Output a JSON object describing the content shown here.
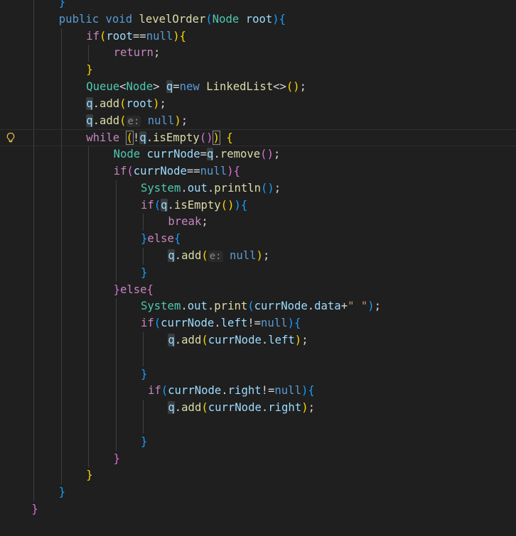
{
  "theme": {
    "background": "#1f1f1f",
    "keyword": "#569cd6",
    "control": "#c586c0",
    "type": "#4ec9b0",
    "function": "#dcdcaa",
    "variable": "#9cdcfe",
    "field": "#9cdcfe",
    "plain": "#d4d4d4",
    "string": "#ce9178",
    "bracket1": "#ffd700",
    "bracket2": "#da70d6",
    "bracket3": "#179fff",
    "hint": "#8a8a8a"
  },
  "editor": {
    "gutter_icon": "lightbulb-icon",
    "lines": [
      {
        "indent": 2,
        "tokens": [
          {
            "t": "}",
            "c": "bracket3"
          }
        ]
      },
      {
        "indent": 2,
        "tokens": [
          {
            "t": "public",
            "c": "keyword"
          },
          {
            "t": " "
          },
          {
            "t": "void",
            "c": "keyword"
          },
          {
            "t": " "
          },
          {
            "t": "levelOrder",
            "c": "function"
          },
          {
            "t": "(",
            "c": "bracket3"
          },
          {
            "t": "Node",
            "c": "type"
          },
          {
            "t": " "
          },
          {
            "t": "root",
            "c": "variable"
          },
          {
            "t": ")",
            "c": "bracket3"
          },
          {
            "t": "{",
            "c": "bracket3"
          }
        ]
      },
      {
        "indent": 3,
        "tokens": [
          {
            "t": "if",
            "c": "control"
          },
          {
            "t": "(",
            "c": "bracket1"
          },
          {
            "t": "root",
            "c": "variable"
          },
          {
            "t": "==",
            "c": "plain"
          },
          {
            "t": "null",
            "c": "keyword"
          },
          {
            "t": ")",
            "c": "bracket1"
          },
          {
            "t": "{",
            "c": "bracket1"
          }
        ]
      },
      {
        "indent": 4,
        "tokens": [
          {
            "t": "return",
            "c": "control"
          },
          {
            "t": ";",
            "c": "plain"
          }
        ]
      },
      {
        "indent": 3,
        "tokens": [
          {
            "t": "}",
            "c": "bracket1"
          }
        ]
      },
      {
        "indent": 3,
        "tokens": [
          {
            "t": "Queue",
            "c": "type"
          },
          {
            "t": "<",
            "c": "plain"
          },
          {
            "t": "Node",
            "c": "type"
          },
          {
            "t": ">",
            "c": "plain"
          },
          {
            "t": " "
          },
          {
            "t": "q",
            "c": "variable",
            "hl": true
          },
          {
            "t": "=",
            "c": "plain"
          },
          {
            "t": "new",
            "c": "keyword"
          },
          {
            "t": " "
          },
          {
            "t": "LinkedList",
            "c": "function"
          },
          {
            "t": "<>",
            "c": "plain"
          },
          {
            "t": "(",
            "c": "bracket1"
          },
          {
            "t": ")",
            "c": "bracket1"
          },
          {
            "t": ";",
            "c": "plain"
          }
        ]
      },
      {
        "indent": 3,
        "tokens": [
          {
            "t": "q",
            "c": "variable",
            "hl": true
          },
          {
            "t": ".",
            "c": "plain"
          },
          {
            "t": "add",
            "c": "function"
          },
          {
            "t": "(",
            "c": "bracket1"
          },
          {
            "t": "root",
            "c": "variable"
          },
          {
            "t": ")",
            "c": "bracket1"
          },
          {
            "t": ";",
            "c": "plain"
          }
        ]
      },
      {
        "indent": 3,
        "tokens": [
          {
            "t": "q",
            "c": "variable",
            "hl": true
          },
          {
            "t": ".",
            "c": "plain"
          },
          {
            "t": "add",
            "c": "function"
          },
          {
            "t": "(",
            "c": "bracket1"
          },
          {
            "t": "e:",
            "c": "hint",
            "hint": true
          },
          {
            "t": " "
          },
          {
            "t": "null",
            "c": "keyword"
          },
          {
            "t": ")",
            "c": "bracket1"
          },
          {
            "t": ";",
            "c": "plain"
          }
        ]
      },
      {
        "indent": 3,
        "current": true,
        "tokens": [
          {
            "t": "while",
            "c": "control"
          },
          {
            "t": " "
          },
          {
            "t": "(",
            "c": "bracket1",
            "match": true
          },
          {
            "t": "!",
            "c": "plain"
          },
          {
            "t": "q",
            "c": "variable",
            "hl": true
          },
          {
            "t": ".",
            "c": "plain"
          },
          {
            "t": "isEmpty",
            "c": "function"
          },
          {
            "t": "(",
            "c": "bracket2"
          },
          {
            "t": ")",
            "c": "bracket2"
          },
          {
            "t": ")",
            "c": "bracket1",
            "match": true
          },
          {
            "t": " "
          },
          {
            "t": "{",
            "c": "bracket1"
          }
        ]
      },
      {
        "indent": 4,
        "tokens": [
          {
            "t": "Node",
            "c": "type"
          },
          {
            "t": " "
          },
          {
            "t": "currNode",
            "c": "variable"
          },
          {
            "t": "=",
            "c": "plain"
          },
          {
            "t": "q",
            "c": "variable",
            "hl": true
          },
          {
            "t": ".",
            "c": "plain"
          },
          {
            "t": "remove",
            "c": "function"
          },
          {
            "t": "(",
            "c": "bracket2"
          },
          {
            "t": ")",
            "c": "bracket2"
          },
          {
            "t": ";",
            "c": "plain"
          }
        ]
      },
      {
        "indent": 4,
        "tokens": [
          {
            "t": "if",
            "c": "control"
          },
          {
            "t": "(",
            "c": "bracket2"
          },
          {
            "t": "currNode",
            "c": "variable"
          },
          {
            "t": "==",
            "c": "plain"
          },
          {
            "t": "null",
            "c": "keyword"
          },
          {
            "t": ")",
            "c": "bracket2"
          },
          {
            "t": "{",
            "c": "bracket2"
          }
        ]
      },
      {
        "indent": 5,
        "tokens": [
          {
            "t": "System",
            "c": "type"
          },
          {
            "t": ".",
            "c": "plain"
          },
          {
            "t": "out",
            "c": "variable"
          },
          {
            "t": ".",
            "c": "plain"
          },
          {
            "t": "println",
            "c": "function"
          },
          {
            "t": "(",
            "c": "bracket3"
          },
          {
            "t": ")",
            "c": "bracket3"
          },
          {
            "t": ";",
            "c": "plain"
          }
        ]
      },
      {
        "indent": 5,
        "tokens": [
          {
            "t": "if",
            "c": "control"
          },
          {
            "t": "(",
            "c": "bracket3"
          },
          {
            "t": "q",
            "c": "variable",
            "hl": true
          },
          {
            "t": ".",
            "c": "plain"
          },
          {
            "t": "isEmpty",
            "c": "function"
          },
          {
            "t": "(",
            "c": "bracket1"
          },
          {
            "t": ")",
            "c": "bracket1"
          },
          {
            "t": ")",
            "c": "bracket3"
          },
          {
            "t": "{",
            "c": "bracket3"
          }
        ]
      },
      {
        "indent": 6,
        "tokens": [
          {
            "t": "break",
            "c": "control"
          },
          {
            "t": ";",
            "c": "plain"
          }
        ]
      },
      {
        "indent": 5,
        "tokens": [
          {
            "t": "}",
            "c": "bracket3"
          },
          {
            "t": "else",
            "c": "control"
          },
          {
            "t": "{",
            "c": "bracket3"
          }
        ]
      },
      {
        "indent": 6,
        "tokens": [
          {
            "t": "q",
            "c": "variable",
            "hl": true
          },
          {
            "t": ".",
            "c": "plain"
          },
          {
            "t": "add",
            "c": "function"
          },
          {
            "t": "(",
            "c": "bracket1"
          },
          {
            "t": "e:",
            "c": "hint",
            "hint": true
          },
          {
            "t": " "
          },
          {
            "t": "null",
            "c": "keyword"
          },
          {
            "t": ")",
            "c": "bracket1"
          },
          {
            "t": ";",
            "c": "plain"
          }
        ]
      },
      {
        "indent": 5,
        "tokens": [
          {
            "t": "}",
            "c": "bracket3"
          }
        ]
      },
      {
        "indent": 4,
        "tokens": [
          {
            "t": "}",
            "c": "bracket2"
          },
          {
            "t": "else",
            "c": "control"
          },
          {
            "t": "{",
            "c": "bracket2"
          }
        ]
      },
      {
        "indent": 5,
        "tokens": [
          {
            "t": "System",
            "c": "type"
          },
          {
            "t": ".",
            "c": "plain"
          },
          {
            "t": "out",
            "c": "variable"
          },
          {
            "t": ".",
            "c": "plain"
          },
          {
            "t": "print",
            "c": "function"
          },
          {
            "t": "(",
            "c": "bracket3"
          },
          {
            "t": "currNode",
            "c": "variable"
          },
          {
            "t": ".",
            "c": "plain"
          },
          {
            "t": "data",
            "c": "field"
          },
          {
            "t": "+",
            "c": "plain"
          },
          {
            "t": "\" \"",
            "c": "string"
          },
          {
            "t": ")",
            "c": "bracket3"
          },
          {
            "t": ";",
            "c": "plain"
          }
        ]
      },
      {
        "indent": 5,
        "tokens": [
          {
            "t": "if",
            "c": "control"
          },
          {
            "t": "(",
            "c": "bracket3"
          },
          {
            "t": "currNode",
            "c": "variable"
          },
          {
            "t": ".",
            "c": "plain"
          },
          {
            "t": "left",
            "c": "field"
          },
          {
            "t": "!=",
            "c": "plain"
          },
          {
            "t": "null",
            "c": "keyword"
          },
          {
            "t": ")",
            "c": "bracket3"
          },
          {
            "t": "{",
            "c": "bracket3"
          }
        ]
      },
      {
        "indent": 6,
        "tokens": [
          {
            "t": "q",
            "c": "variable",
            "hl": true
          },
          {
            "t": ".",
            "c": "plain"
          },
          {
            "t": "add",
            "c": "function"
          },
          {
            "t": "(",
            "c": "bracket1"
          },
          {
            "t": "currNode",
            "c": "variable"
          },
          {
            "t": ".",
            "c": "plain"
          },
          {
            "t": "left",
            "c": "field"
          },
          {
            "t": ")",
            "c": "bracket1"
          },
          {
            "t": ";",
            "c": "plain"
          }
        ]
      },
      {
        "indent": 6,
        "tokens": []
      },
      {
        "indent": 5,
        "tokens": [
          {
            "t": "}",
            "c": "bracket3"
          }
        ]
      },
      {
        "indent": 5,
        "extra": 1,
        "tokens": [
          {
            "t": "if",
            "c": "control"
          },
          {
            "t": "(",
            "c": "bracket3"
          },
          {
            "t": "currNode",
            "c": "variable"
          },
          {
            "t": ".",
            "c": "plain"
          },
          {
            "t": "right",
            "c": "field"
          },
          {
            "t": "!=",
            "c": "plain"
          },
          {
            "t": "null",
            "c": "keyword"
          },
          {
            "t": ")",
            "c": "bracket3"
          },
          {
            "t": "{",
            "c": "bracket3"
          }
        ]
      },
      {
        "indent": 6,
        "tokens": [
          {
            "t": "q",
            "c": "variable",
            "hl": true
          },
          {
            "t": ".",
            "c": "plain"
          },
          {
            "t": "add",
            "c": "function"
          },
          {
            "t": "(",
            "c": "bracket1"
          },
          {
            "t": "currNode",
            "c": "variable"
          },
          {
            "t": ".",
            "c": "plain"
          },
          {
            "t": "right",
            "c": "field"
          },
          {
            "t": ")",
            "c": "bracket1"
          },
          {
            "t": ";",
            "c": "plain"
          }
        ]
      },
      {
        "indent": 6,
        "tokens": []
      },
      {
        "indent": 5,
        "tokens": [
          {
            "t": "}",
            "c": "bracket3"
          }
        ]
      },
      {
        "indent": 4,
        "tokens": [
          {
            "t": "}",
            "c": "bracket2"
          }
        ]
      },
      {
        "indent": 3,
        "tokens": [
          {
            "t": "}",
            "c": "bracket1"
          }
        ]
      },
      {
        "indent": 2,
        "tokens": [
          {
            "t": "}",
            "c": "bracket3"
          }
        ]
      },
      {
        "indent": 1,
        "tokens": [
          {
            "t": "}",
            "c": "bracket2"
          }
        ]
      }
    ]
  }
}
